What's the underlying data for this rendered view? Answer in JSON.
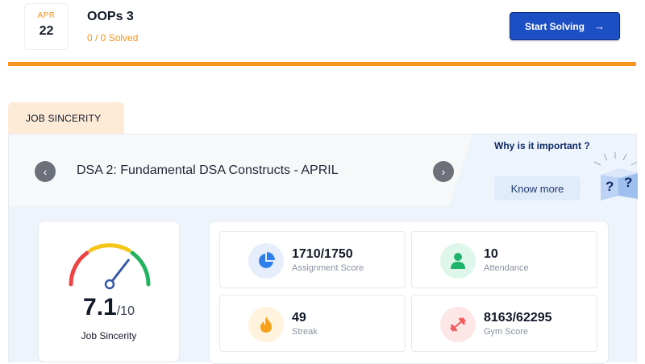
{
  "problem": {
    "date_month": "APR",
    "date_day": "22",
    "title": "OOPs 3",
    "solved": "0 / 0 Solved",
    "start_label": "Start Solving",
    "arrow": "→"
  },
  "tab": {
    "label": "JOB SINCERITY"
  },
  "banner": {
    "prev": "‹",
    "next": "›",
    "course_title": "DSA 2: Fundamental DSA Constructs - APRIL",
    "why_text": "Why is it important ?",
    "know_more": "Know more",
    "qmark_left": "?",
    "qmark_right": "?"
  },
  "sincerity": {
    "value": "7.1",
    "max": "/10",
    "label": "Job Sincerity",
    "gauge_level": 0.71
  },
  "stats": [
    {
      "value": "1710/1750",
      "label": "Assignment Score",
      "icon": "pie-chart-icon",
      "icon_color": "#2f80ed",
      "bg": "#e6eefc"
    },
    {
      "value": "10",
      "label": "Attendance",
      "icon": "user-icon",
      "icon_color": "#1db36b",
      "bg": "#def7ea"
    },
    {
      "value": "49",
      "label": "Streak",
      "icon": "flame-icon",
      "icon_color": "#f7a21b",
      "bg": "#fff3dd"
    },
    {
      "value": "8163/62295",
      "label": "Gym Score",
      "icon": "dumbbell-icon",
      "icon_color": "#ef5a5a",
      "bg": "#fde6e6"
    }
  ],
  "colors": {
    "accent_orange": "#f7931e",
    "primary_blue": "#1d4fc4",
    "gauge_red": "#ef4444",
    "gauge_yellow": "#f5c518",
    "gauge_green": "#22b35e",
    "needle": "#3558a8"
  }
}
